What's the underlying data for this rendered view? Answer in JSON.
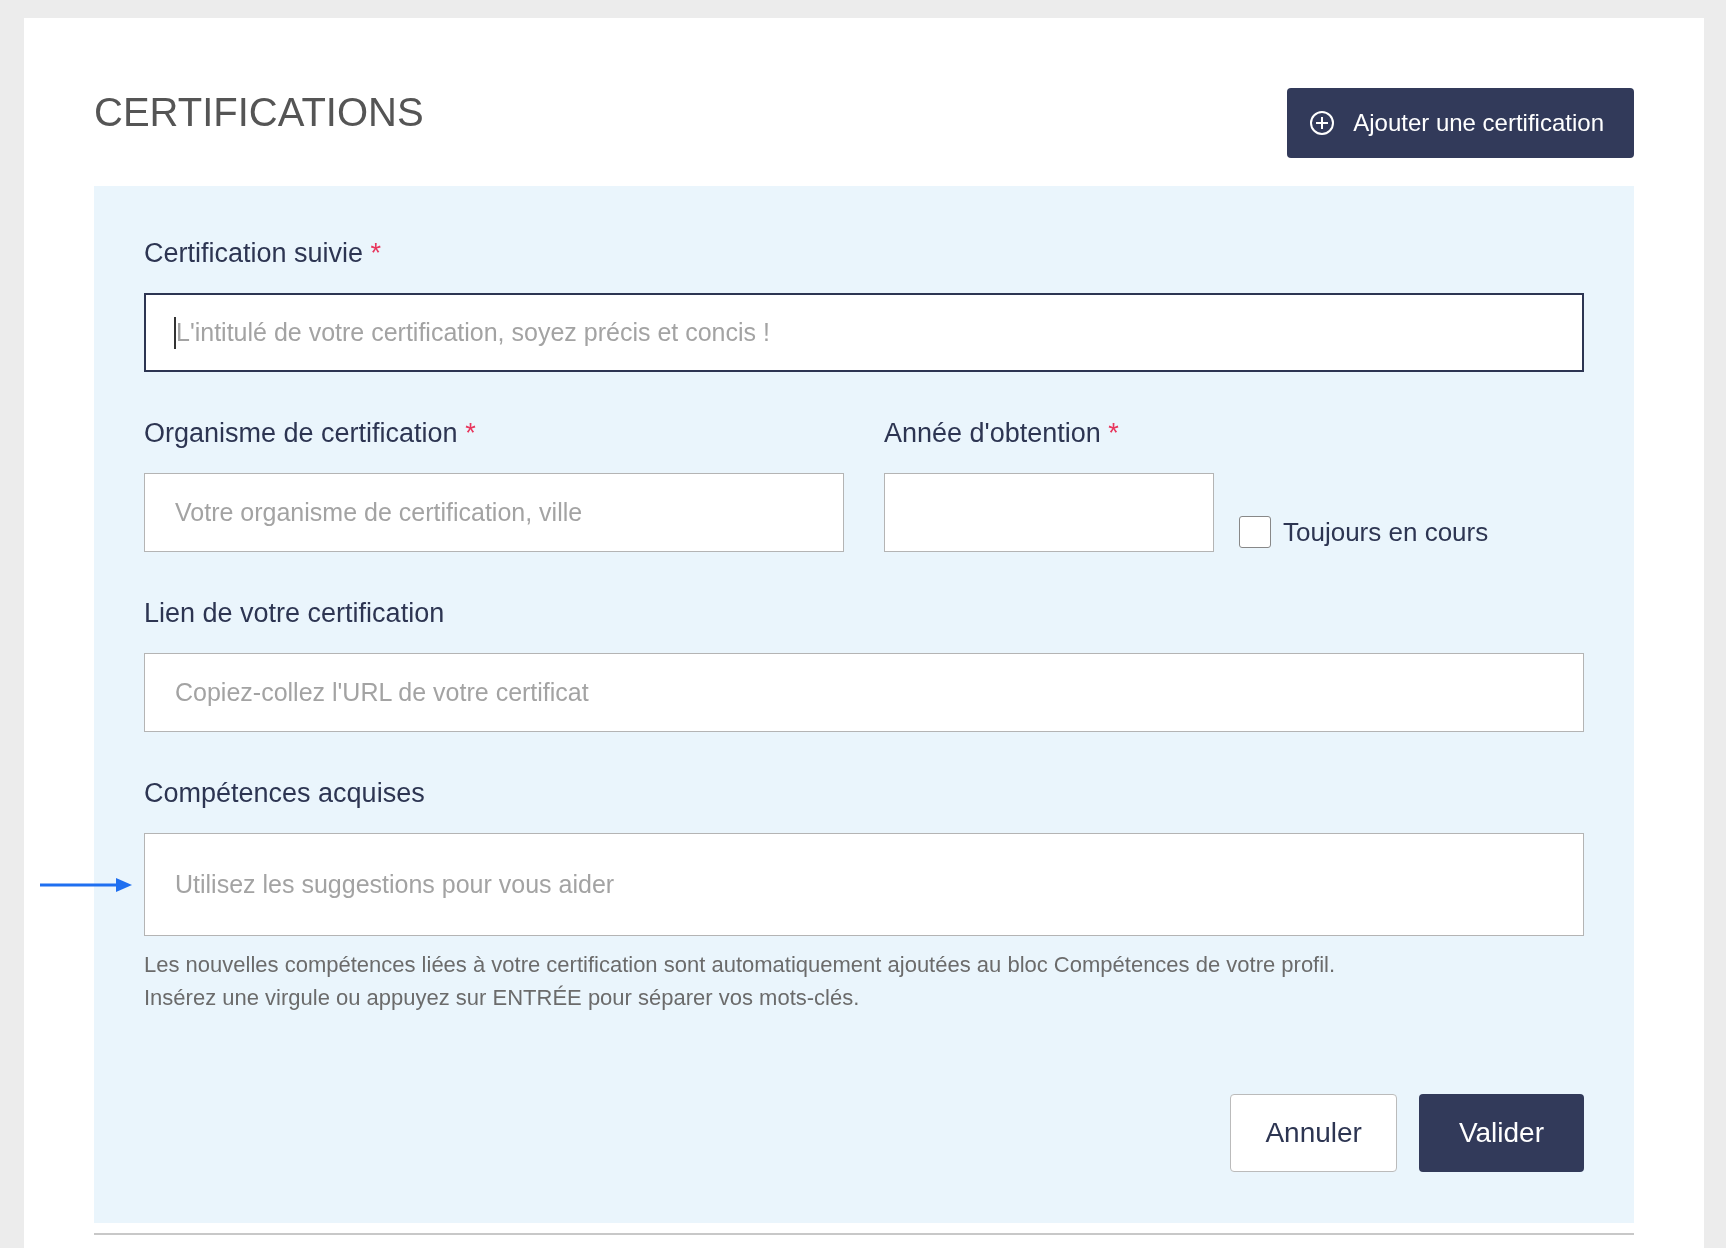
{
  "title": "CERTIFICATIONS",
  "add_button": {
    "label": "Ajouter une certification"
  },
  "rows": [
    {
      "fields": [
        {
          "label": "Certification suivie",
          "required_mark": "*",
          "placeholder": "L'intitulé de votre certification, soyez précis et concis !",
          "focused": true
        }
      ]
    },
    {
      "fields": [
        {
          "label": "Organisme de certification",
          "required_mark": "*",
          "placeholder": "Votre organisme de certification, ville",
          "focused": false
        },
        {
          "label": "Année d'obtention",
          "required_mark": "*",
          "focused": false
        }
      ],
      "checkbox": {
        "label": "Toujours en cours",
        "checked": false
      }
    },
    {
      "fields": [
        {
          "label": "Lien de votre certification",
          "placeholder": "Copiez-collez l'URL de votre certificat",
          "focused": false
        }
      ]
    },
    {
      "fields": [
        {
          "label": "Compétences acquises",
          "placeholder": "Utilisez les suggestions pour vous aider",
          "focused": false,
          "pointer": true
        }
      ],
      "help_lines": [
        "Les nouvelles compétences liées à votre certification sont automatiquement ajoutées au bloc Compétences de votre profil.",
        "Insérez une virgule ou appuyez sur ENTRÉE pour séparer vos mots-clés."
      ]
    }
  ],
  "buttons": [
    {
      "label": "Annuler",
      "kind": "secondary"
    },
    {
      "label": "Valider",
      "kind": "primary"
    }
  ]
}
